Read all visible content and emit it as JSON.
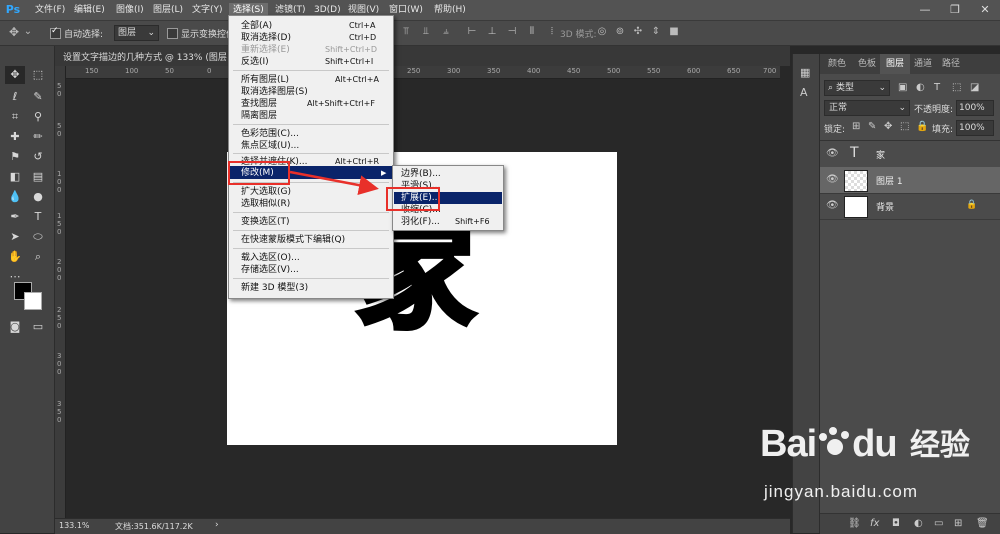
{
  "app": {
    "logo": "Ps"
  },
  "menubar": {
    "items": [
      "文件(F)",
      "编辑(E)",
      "图像(I)",
      "图层(L)",
      "文字(Y)",
      "选择(S)",
      "滤镜(T)",
      "3D(D)",
      "视图(V)",
      "窗口(W)",
      "帮助(H)"
    ],
    "window_controls": [
      "—",
      "❐",
      "✕"
    ]
  },
  "options": {
    "auto_select_label": "自动选择:",
    "auto_select_value": "图层",
    "show_transform_label": "显示变换控件",
    "mode_3d_label": "3D 模式:"
  },
  "document": {
    "tab_title": "设置文字描边的几种方式 @ 133% (图层 1",
    "canvas_glyph": "家",
    "ruler_h": [
      "150",
      "100",
      "50",
      "0",
      "50",
      "100",
      "150",
      "200",
      "250",
      "300",
      "350",
      "400",
      "450",
      "500",
      "550",
      "600",
      "650",
      "700"
    ],
    "ruler_v": [
      "5",
      "0",
      "5",
      "0",
      "1",
      "0",
      "0",
      "1",
      "5",
      "0",
      "2",
      "0",
      "0",
      "2",
      "5",
      "0",
      "3",
      "0",
      "0",
      "3",
      "5",
      "0"
    ]
  },
  "status": {
    "zoom": "133.1%",
    "doc_info": "文档:351.6K/117.2K",
    "arrow": "›"
  },
  "select_menu": {
    "groups": [
      [
        {
          "label": "全部(A)",
          "shortcut": "Ctrl+A",
          "disabled": false
        },
        {
          "label": "取消选择(D)",
          "shortcut": "Ctrl+D",
          "disabled": false
        },
        {
          "label": "重新选择(E)",
          "shortcut": "Shift+Ctrl+D",
          "disabled": true
        },
        {
          "label": "反选(I)",
          "shortcut": "Shift+Ctrl+I",
          "disabled": false
        }
      ],
      [
        {
          "label": "所有图层(L)",
          "shortcut": "Alt+Ctrl+A",
          "disabled": false
        },
        {
          "label": "取消选择图层(S)",
          "shortcut": "",
          "disabled": false
        },
        {
          "label": "查找图层",
          "shortcut": "Alt+Shift+Ctrl+F",
          "disabled": false
        },
        {
          "label": "隔离图层",
          "shortcut": "",
          "disabled": false
        }
      ],
      [
        {
          "label": "色彩范围(C)...",
          "shortcut": "",
          "disabled": false
        },
        {
          "label": "焦点区域(U)...",
          "shortcut": "",
          "disabled": false
        }
      ],
      [
        {
          "label": "选择并遮住(K)...",
          "shortcut": "Alt+Ctrl+R",
          "disabled": false
        },
        {
          "label": "修改(M)",
          "shortcut": "",
          "disabled": false,
          "highlighted": true,
          "submenu": true
        }
      ],
      [
        {
          "label": "扩大选取(G)",
          "shortcut": "",
          "disabled": false
        },
        {
          "label": "选取相似(R)",
          "shortcut": "",
          "disabled": false
        }
      ],
      [
        {
          "label": "变换选区(T)",
          "shortcut": "",
          "disabled": false
        }
      ],
      [
        {
          "label": "在快速蒙版模式下编辑(Q)",
          "shortcut": "",
          "disabled": false
        }
      ],
      [
        {
          "label": "载入选区(O)...",
          "shortcut": "",
          "disabled": false
        },
        {
          "label": "存储选区(V)...",
          "shortcut": "",
          "disabled": false
        }
      ],
      [
        {
          "label": "新建 3D 模型(3)",
          "shortcut": "",
          "disabled": false
        }
      ]
    ]
  },
  "modify_submenu": {
    "items": [
      {
        "label": "边界(B)...",
        "shortcut": ""
      },
      {
        "label": "平滑(S)...",
        "shortcut": ""
      },
      {
        "label": "扩展(E)...",
        "shortcut": "",
        "highlighted": true
      },
      {
        "label": "收缩(C)...",
        "shortcut": ""
      },
      {
        "label": "羽化(F)...",
        "shortcut": "Shift+F6"
      }
    ]
  },
  "panels": {
    "tabs": [
      "颜色",
      "色板",
      "图层",
      "通道",
      "路径"
    ],
    "active_tab": "图层",
    "filter_kind": "类型",
    "blend_mode": "正常",
    "opacity_label": "不透明度:",
    "opacity_value": "100%",
    "lock_label": "锁定:",
    "fill_label": "填充:",
    "fill_value": "100%",
    "layers": [
      {
        "name": "家",
        "kind": "text"
      },
      {
        "name": "图层 1",
        "kind": "pixel",
        "selected": true
      },
      {
        "name": "背景",
        "kind": "background",
        "locked": true
      }
    ]
  },
  "watermark": {
    "brand": "Bai",
    "brand_tail": "du",
    "cn": "经验",
    "url": "jingyan.baidu.com"
  },
  "colors": {
    "highlight": "#0a246a",
    "annotation": "#e8302a",
    "ps_blue": "#31a8ff"
  }
}
